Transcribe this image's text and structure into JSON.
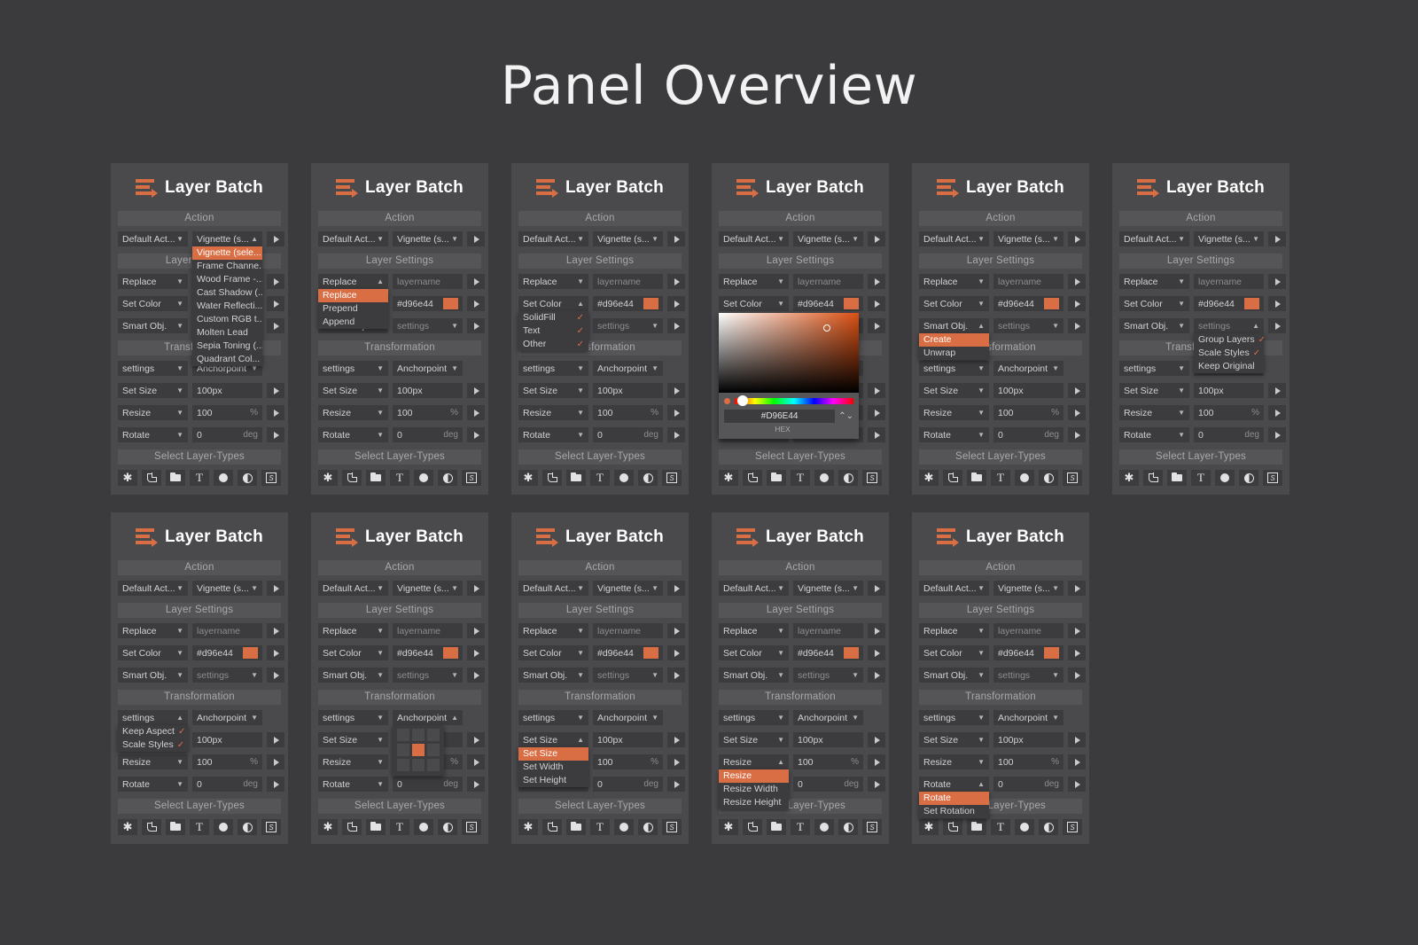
{
  "page": {
    "title": "Panel Overview"
  },
  "theme": {
    "accent": "#d96e44",
    "panel_bg": "#4a4a4d",
    "control_bg": "#3c3c3f",
    "page_bg": "#3b3b3e",
    "section_bg": "#555558"
  },
  "panel": {
    "title": "Layer Batch",
    "logo_icon": "layer-batch-logo-icon",
    "sections": {
      "action": "Action",
      "layer_settings": "Layer Settings",
      "transformation": "Transformation",
      "select_layer_types": "Select Layer-Types"
    },
    "action_row": {
      "preset": "Default Act...",
      "action": "Vignette (s...",
      "run": "run-icon"
    },
    "layer_settings_rows": [
      {
        "mode": "Replace",
        "value": "layername",
        "value_dim": true
      },
      {
        "mode": "Set Color",
        "value": "#d96e44",
        "swatch": "#d96e44"
      },
      {
        "mode": "Smart Obj.",
        "value": "settings",
        "value_dim": true
      }
    ],
    "transformation_rows": [
      {
        "mode": "settings",
        "value": "Anchorpoint",
        "is_select": true
      },
      {
        "mode": "Set Size",
        "value": "100px",
        "unit": ""
      },
      {
        "mode": "Resize",
        "value": "100",
        "unit": "%"
      },
      {
        "mode": "Rotate",
        "value": "0",
        "unit": "deg"
      }
    ],
    "layer_type_icons": [
      "all-layers-icon",
      "pixel-layer-icon",
      "group-layer-icon",
      "text-layer-icon",
      "shape-layer-icon",
      "adjustment-layer-icon",
      "smart-object-layer-icon"
    ]
  },
  "dropdowns": {
    "actions": {
      "selected": "Vignette (sele...",
      "options": [
        "Vignette (sele...",
        "Frame Channe...",
        "Wood Frame -...",
        "Cast Shadow (...",
        "Water Reflecti...",
        "Custom RGB t...",
        "Molten Lead",
        "Sepia Toning (...",
        "Quadrant Col..."
      ]
    },
    "rename_mode": {
      "selected": "Replace",
      "options": [
        "Replace",
        "Prepend",
        "Append"
      ]
    },
    "color_targets": {
      "header": "Set Color",
      "options": [
        {
          "label": "SolidFill",
          "checked": true
        },
        {
          "label": "Text",
          "checked": true
        },
        {
          "label": "Other",
          "checked": true
        }
      ]
    },
    "smart_object": {
      "selected": "Create",
      "options": [
        "Create",
        "Unwrap"
      ]
    },
    "smart_object_settings": {
      "header": "settings",
      "options": [
        {
          "label": "Group Layers",
          "checked": true
        },
        {
          "label": "Scale Styles",
          "checked": true
        },
        {
          "label": "Keep Original",
          "checked": false
        }
      ]
    },
    "transform_settings": {
      "header": "settings",
      "options": [
        {
          "label": "Keep Aspect",
          "checked": true
        },
        {
          "label": "Scale Styles",
          "checked": true
        }
      ]
    },
    "size_mode": {
      "selected": "Set Size",
      "options": [
        "Set Size",
        "Set Width",
        "Set Height"
      ]
    },
    "resize_mode": {
      "selected": "Resize",
      "options": [
        "Resize",
        "Resize Width",
        "Resize Height"
      ]
    },
    "rotate_mode": {
      "selected": "Rotate",
      "options": [
        "Rotate",
        "Set Rotation"
      ]
    },
    "anchorpoint": {
      "header": "Anchorpoint",
      "selected_cell": 4,
      "cells": 9
    }
  },
  "color_picker": {
    "hex_value": "#D96E44",
    "hex_label": "HEX",
    "swatch": "#d96e44"
  },
  "panels": [
    {
      "id": "panel-1",
      "open": "actions"
    },
    {
      "id": "panel-2",
      "open": "rename_mode"
    },
    {
      "id": "panel-3",
      "open": "color_targets"
    },
    {
      "id": "panel-4",
      "open": "color_picker"
    },
    {
      "id": "panel-5",
      "open": "smart_object"
    },
    {
      "id": "panel-6",
      "open": "smart_object_settings"
    },
    {
      "id": "panel-7",
      "open": "transform_settings"
    },
    {
      "id": "panel-8",
      "open": "anchorpoint"
    },
    {
      "id": "panel-9",
      "open": "size_mode"
    },
    {
      "id": "panel-10",
      "open": "resize_mode"
    },
    {
      "id": "panel-11",
      "open": "rotate_mode"
    }
  ]
}
